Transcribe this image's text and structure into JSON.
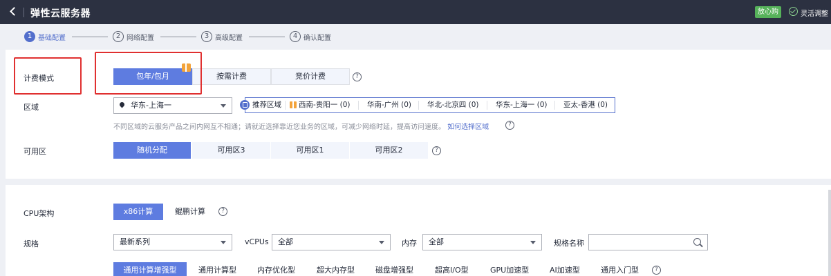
{
  "header": {
    "back_icon": "chevron-left-icon",
    "title": "弹性云服务器",
    "badge": "放心购",
    "flex_label": "灵活调整",
    "flex_icon": "check-circle-icon"
  },
  "steps": [
    {
      "num": "1",
      "label": "基础配置",
      "active": true
    },
    {
      "num": "2",
      "label": "网络配置",
      "active": false
    },
    {
      "num": "3",
      "label": "高级配置",
      "active": false
    },
    {
      "num": "4",
      "label": "确认配置",
      "active": false
    }
  ],
  "billing": {
    "label": "计费模式",
    "options": [
      "包年/包月",
      "按需计费",
      "竞价计费"
    ],
    "selected": "包年/包月"
  },
  "region": {
    "label": "区域",
    "select_value": "华东-上海一",
    "recommended_label": "推荐区域",
    "recommended": [
      "西南-贵阳一 (0)",
      "华南-广州 (0)",
      "华北-北京四 (0)",
      "华东-上海一 (0)",
      "亚太-香港 (0)"
    ],
    "hint": "不同区域的云服务产品之间内网互不相通；请就近选择靠近您业务的区域，可减少网络时延，提高访问速度。",
    "hint_link": "如何选择区域"
  },
  "az": {
    "label": "可用区",
    "options": [
      "随机分配",
      "可用区3",
      "可用区1",
      "可用区2"
    ],
    "selected": "随机分配"
  },
  "cpu": {
    "label": "CPU架构",
    "options": [
      "x86计算",
      "鲲鹏计算"
    ],
    "selected": "x86计算"
  },
  "spec": {
    "label": "规格",
    "series": "最新系列",
    "vcpus_label": "vCPUs",
    "vcpus_value": "全部",
    "mem_label": "内存",
    "mem_value": "全部",
    "name_label": "规格名称",
    "name_placeholder": "",
    "tabs": [
      "通用计算增强型",
      "通用计算型",
      "内存优化型",
      "超大内存型",
      "磁盘增强型",
      "超高I/O型",
      "GPU加速型",
      "AI加速型",
      "通用入门型"
    ],
    "selected_tab": "通用计算增强型"
  },
  "colors": {
    "primary": "#5e7ce0",
    "topbar": "#2c3141",
    "highlight": "#e03030",
    "badge": "#56b25a"
  }
}
